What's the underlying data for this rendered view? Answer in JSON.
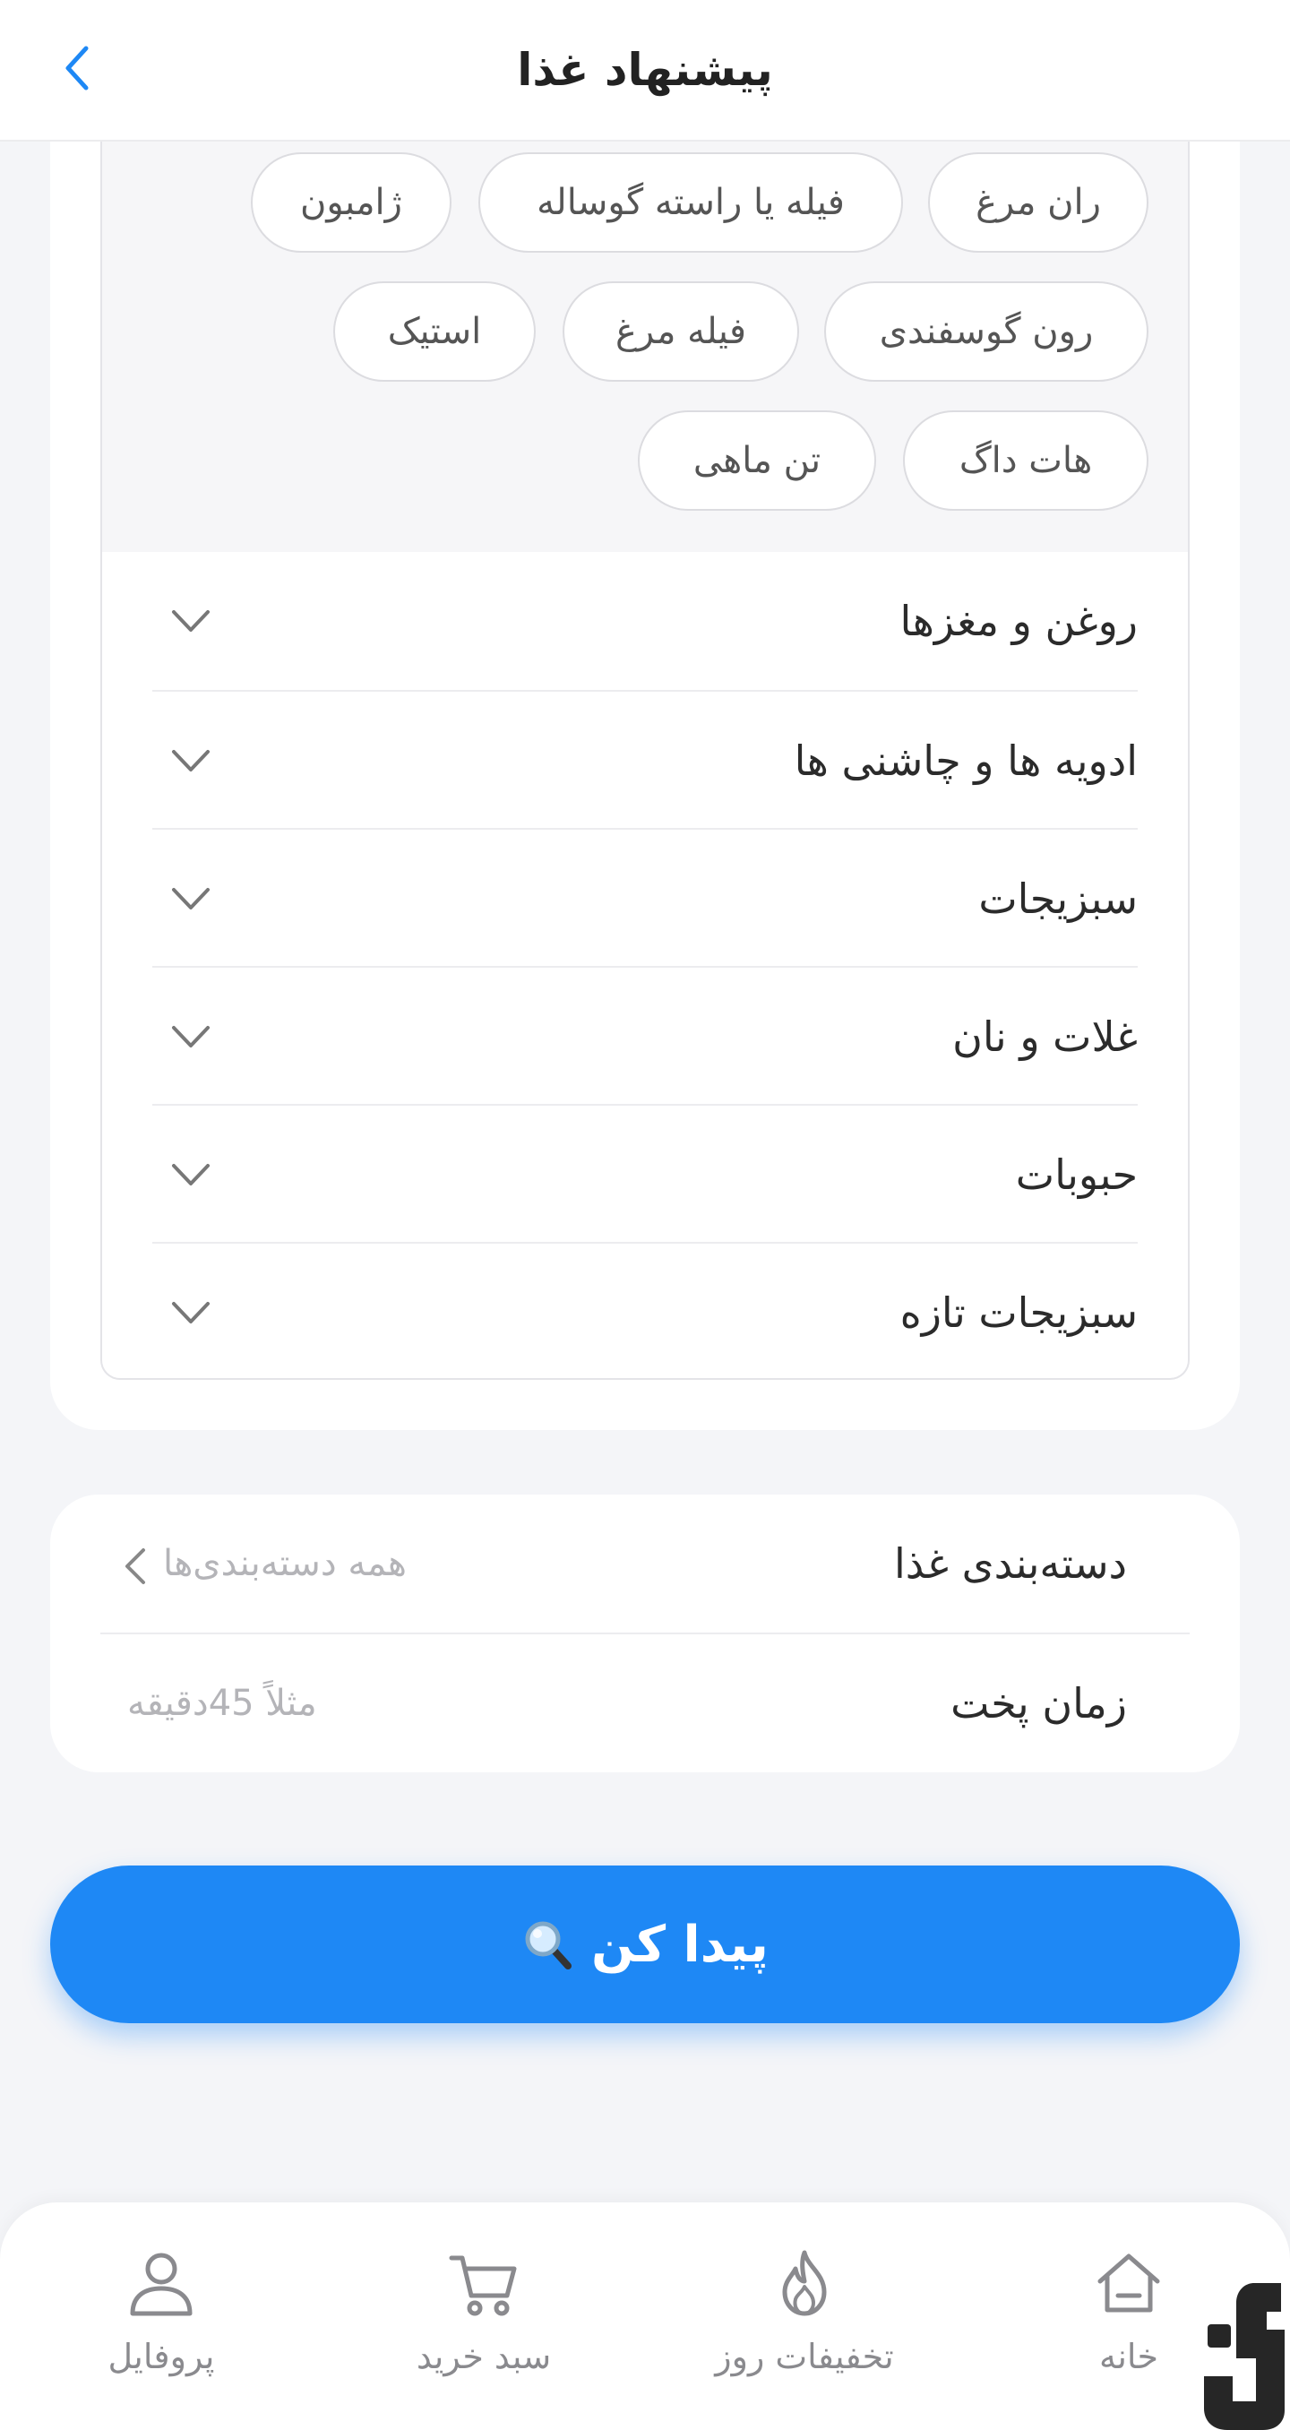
{
  "header": {
    "title": "پیشنهاد غذا"
  },
  "chips": [
    {
      "label": "ران مرغ"
    },
    {
      "label": "فیله یا راسته گوساله"
    },
    {
      "label": "ژامبون"
    },
    {
      "label": "رون گوسفندی"
    },
    {
      "label": "فیله مرغ"
    },
    {
      "label": "استیک"
    },
    {
      "label": "هات داگ"
    },
    {
      "label": "تن ماهی"
    }
  ],
  "categories": [
    {
      "label": "روغن و مغزها"
    },
    {
      "label": "ادویه ها و چاشنی ها"
    },
    {
      "label": "سبزیجات"
    },
    {
      "label": "غلات و نان"
    },
    {
      "label": "حبوبات"
    },
    {
      "label": "سبزیجات تازه"
    }
  ],
  "filters": {
    "category": {
      "label": "دسته‌بندی غذا",
      "value": "همه دسته‌بندی‌ها"
    },
    "cook_time": {
      "label": "زمان پخت",
      "placeholder": "مثلاً 45دقیقه"
    }
  },
  "find_button": {
    "label": "پیدا کن",
    "icon": "magnifier-icon"
  },
  "bottom_nav": [
    {
      "label": "خانه",
      "icon": "home-icon"
    },
    {
      "label": "تخفیفات روز",
      "icon": "flame-icon"
    },
    {
      "label": "سبد خرید",
      "icon": "cart-icon"
    },
    {
      "label": "پروفایل",
      "icon": "user-icon"
    }
  ],
  "colors": {
    "accent": "#1e88f5",
    "background": "#f4f5f8",
    "card": "#ffffff"
  }
}
